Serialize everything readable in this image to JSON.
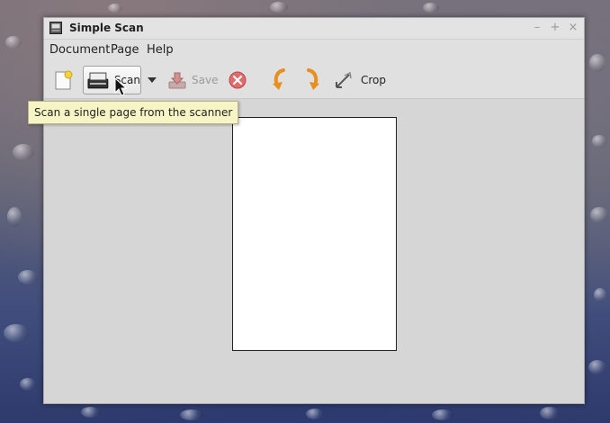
{
  "window": {
    "title": "Simple Scan",
    "icon": "scanner-app-icon",
    "controls": [
      "minimize-icon",
      "maximize-icon",
      "close-icon"
    ]
  },
  "menubar": {
    "items": [
      {
        "label": "Document"
      },
      {
        "label": "Page"
      },
      {
        "label": "Help"
      }
    ]
  },
  "toolbar": {
    "new_icon": "new-document-icon",
    "scan_label": "Scan",
    "scan_icon": "scanner-icon",
    "scan_dropdown_icon": "chevron-down-icon",
    "save_label": "Save",
    "save_icon": "save-icon",
    "stop_icon": "stop-icon",
    "rotate_left_icon": "rotate-left-icon",
    "rotate_right_icon": "rotate-right-icon",
    "crop_label": "Crop",
    "crop_icon": "crop-icon"
  },
  "tooltip": {
    "text": "Scan a single page from the scanner"
  },
  "document": {
    "page_count": 1
  },
  "colors": {
    "window_bg": "#d6d6d6",
    "tooltip_bg": "#f7f5c5",
    "stop_red": "#e05555",
    "rotate_orange": "#f0a030"
  }
}
